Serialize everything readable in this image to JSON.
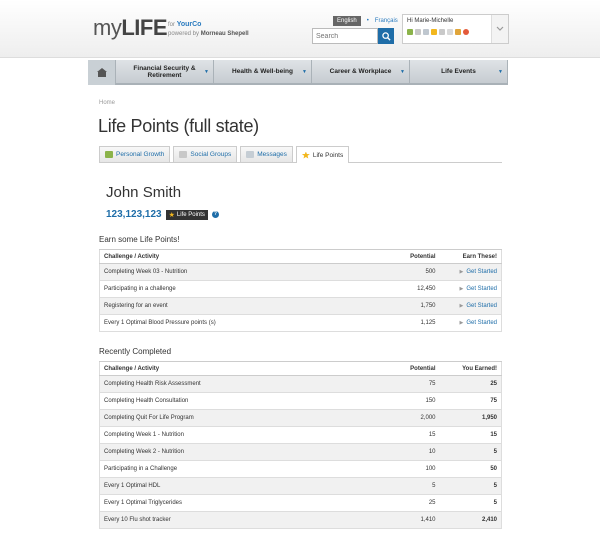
{
  "header": {
    "logo_my": "my",
    "logo_life": "LIFE",
    "sponsor_for": "for",
    "sponsor_company": "YourCo",
    "powered_by": "powered by",
    "powered_company": "Morneau Shepell",
    "lang_active": "English",
    "lang_sep": "•",
    "lang_other": "Français",
    "search_placeholder": "Search",
    "user_greeting": "Hi Marie-Michelle"
  },
  "nav": {
    "items": [
      {
        "label": "Financial Security & Retirement"
      },
      {
        "label": "Health & Well-being"
      },
      {
        "label": "Career & Workplace"
      },
      {
        "label": "Life Events"
      }
    ]
  },
  "breadcrumb": "Home",
  "page_title": "Life Points (full state)",
  "tabs": [
    {
      "label": "Personal Growth"
    },
    {
      "label": "Social Groups"
    },
    {
      "label": "Messages"
    },
    {
      "label": "Life Points"
    }
  ],
  "profile": {
    "name": "John Smith",
    "points": "123,123,123",
    "badge": "Life Points",
    "help": "?"
  },
  "earn": {
    "title": "Earn some Life Points!",
    "headers": [
      "Challenge / Activity",
      "Potential",
      "Earn These!"
    ],
    "rows": [
      {
        "activity": "Completing Week 03 - Nutrition",
        "potential": "500",
        "action": "Get Started"
      },
      {
        "activity": "Participating in a challenge",
        "potential": "12,450",
        "action": "Get Started"
      },
      {
        "activity": "Registering for an event",
        "potential": "1,750",
        "action": "Get Started"
      },
      {
        "activity": "Every 1 Optimal Blood Pressure points (s)",
        "potential": "1,125",
        "action": "Get Started"
      }
    ]
  },
  "completed": {
    "title": "Recently Completed",
    "headers": [
      "Challenge / Activity",
      "Potential",
      "You Earned!"
    ],
    "rows": [
      {
        "activity": "Completing Health Risk Assessment",
        "potential": "75",
        "earned": "25"
      },
      {
        "activity": "Completing Health Consultation",
        "potential": "150",
        "earned": "75"
      },
      {
        "activity": "Completing Quit For Life Program",
        "potential": "2,000",
        "earned": "1,950"
      },
      {
        "activity": "Completing Week 1 - Nutrition",
        "potential": "15",
        "earned": "15"
      },
      {
        "activity": "Completing Week 2 - Nutrition",
        "potential": "10",
        "earned": "5"
      },
      {
        "activity": "Participating in a Challenge",
        "potential": "100",
        "earned": "50"
      },
      {
        "activity": "Every 1 Optimal HDL",
        "potential": "5",
        "earned": "5"
      },
      {
        "activity": "Every 1 Optimal Triglycerides",
        "potential": "25",
        "earned": "5"
      },
      {
        "activity": "Every 10 Flu shot tracker",
        "potential": "1,410",
        "earned": "2,410"
      }
    ]
  },
  "colors": {
    "accent": "#1e6da8",
    "star": "#f2b71e"
  }
}
